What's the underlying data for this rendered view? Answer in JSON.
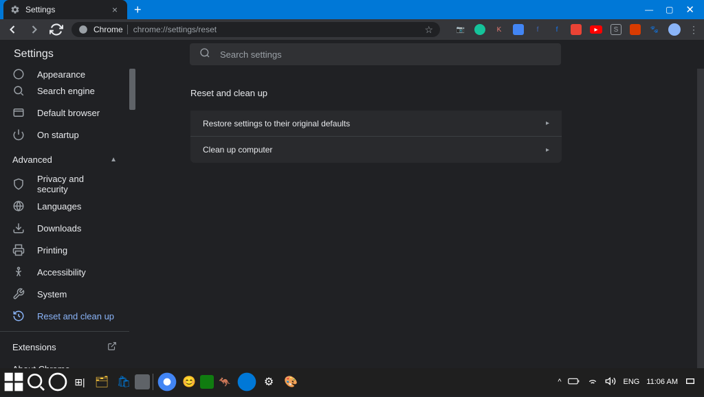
{
  "titlebar": {
    "tab_title": "Settings"
  },
  "toolbar": {
    "addr_label": "Chrome",
    "addr_url": "chrome://settings/reset"
  },
  "header": {
    "title": "Settings",
    "search_placeholder": "Search settings"
  },
  "sidebar": {
    "items": [
      {
        "label": "Appearance"
      },
      {
        "label": "Search engine"
      },
      {
        "label": "Default browser"
      },
      {
        "label": "On startup"
      }
    ],
    "advanced": "Advanced",
    "adv_items": [
      {
        "label": "Privacy and security"
      },
      {
        "label": "Languages"
      },
      {
        "label": "Downloads"
      },
      {
        "label": "Printing"
      },
      {
        "label": "Accessibility"
      },
      {
        "label": "System"
      },
      {
        "label": "Reset and clean up"
      }
    ],
    "extensions": "Extensions",
    "about": "About Chrome"
  },
  "main": {
    "section_title": "Reset and clean up",
    "options": [
      {
        "label": "Restore settings to their original defaults"
      },
      {
        "label": "Clean up computer"
      }
    ]
  },
  "taskbar": {
    "lang": "ENG",
    "time": "11:06 AM"
  }
}
